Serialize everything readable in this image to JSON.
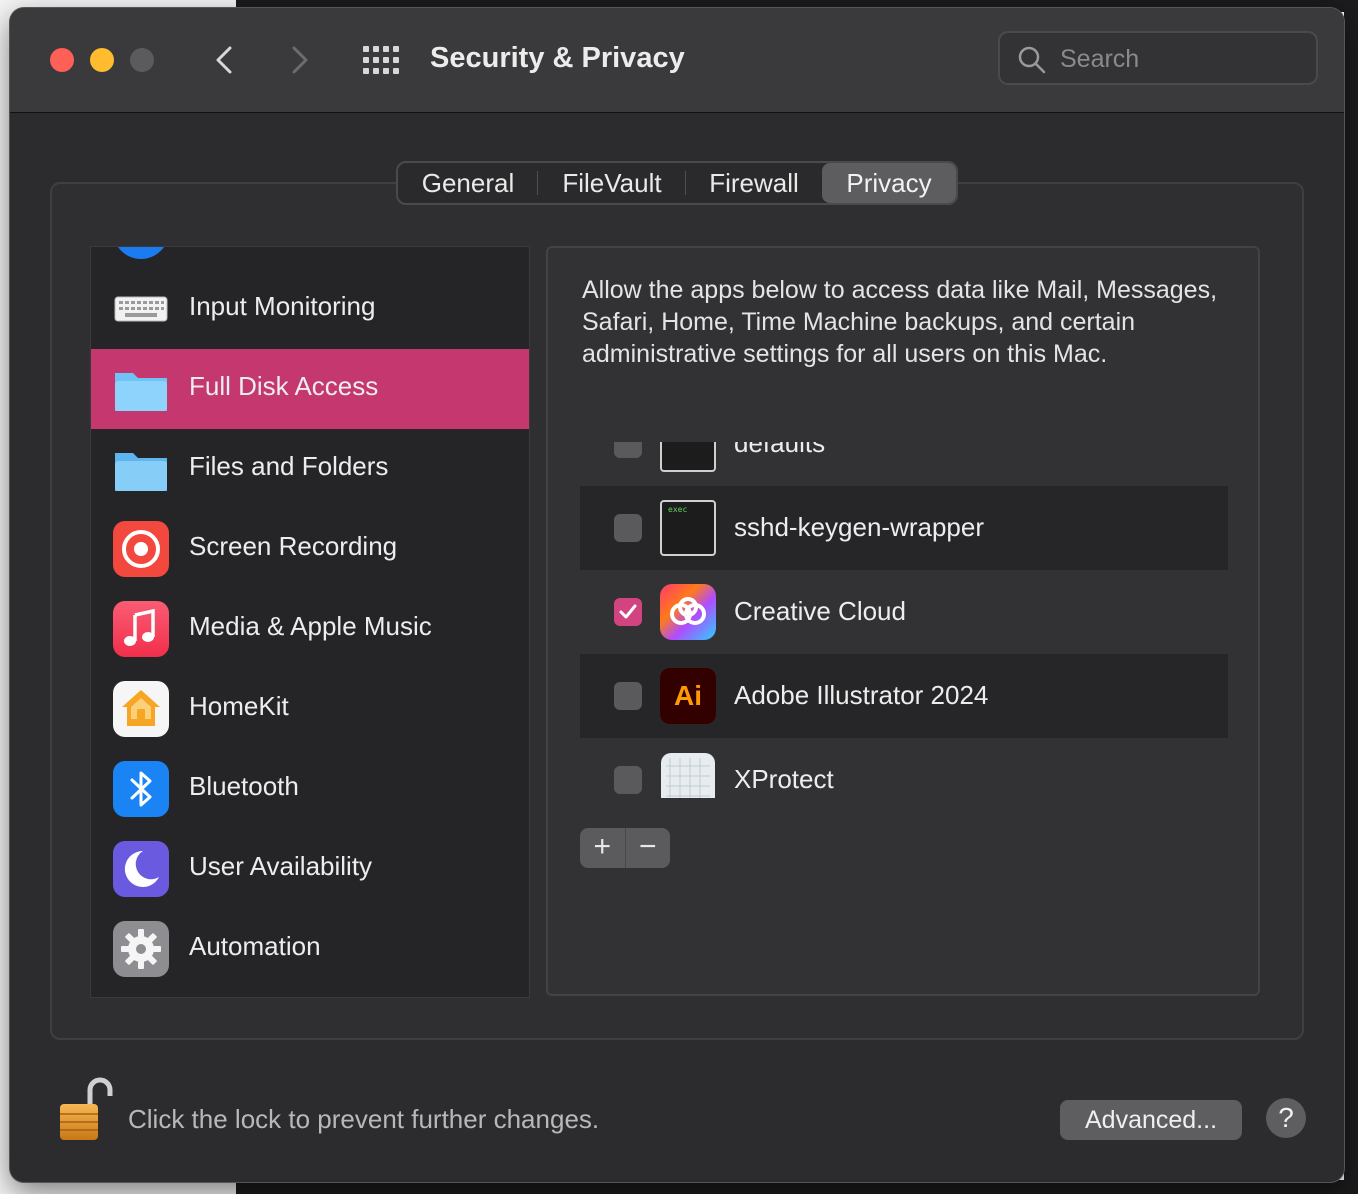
{
  "window": {
    "title": "Security & Privacy"
  },
  "search": {
    "placeholder": "Search"
  },
  "tabs": [
    {
      "label": "General"
    },
    {
      "label": "FileVault"
    },
    {
      "label": "Firewall"
    },
    {
      "label": "Privacy",
      "active": true
    }
  ],
  "sidebar": {
    "items": [
      {
        "label": "Input Monitoring",
        "icon": "keyboard-icon"
      },
      {
        "label": "Full Disk Access",
        "icon": "folder-icon",
        "selected": true
      },
      {
        "label": "Files and Folders",
        "icon": "folder-icon"
      },
      {
        "label": "Screen Recording",
        "icon": "screen-recording-icon"
      },
      {
        "label": "Media & Apple Music",
        "icon": "music-note-icon"
      },
      {
        "label": "HomeKit",
        "icon": "home-icon"
      },
      {
        "label": "Bluetooth",
        "icon": "bluetooth-icon"
      },
      {
        "label": "User Availability",
        "icon": "moon-icon"
      },
      {
        "label": "Automation",
        "icon": "gear-icon"
      }
    ]
  },
  "content": {
    "description": "Allow the apps below to access data like Mail, Messages, Safari, Home, Time Machine backups, and certain administrative settings for all users on this Mac.",
    "apps": [
      {
        "name": "defaults",
        "checked": false,
        "icon": "terminal-exec-icon"
      },
      {
        "name": "sshd-keygen-wrapper",
        "checked": false,
        "icon": "terminal-exec-icon",
        "icon_text": "exec"
      },
      {
        "name": "Creative Cloud",
        "checked": true,
        "icon": "creative-cloud-icon"
      },
      {
        "name": "Adobe Illustrator 2024",
        "checked": false,
        "icon": "illustrator-icon",
        "icon_text": "Ai"
      },
      {
        "name": "XProtect",
        "checked": false,
        "icon": "xprotect-icon"
      }
    ],
    "add_label": "+",
    "remove_label": "−"
  },
  "footer": {
    "lock_text": "Click the lock to prevent further changes.",
    "advanced_label": "Advanced...",
    "help_label": "?"
  },
  "colors": {
    "selection": "#c4376f",
    "checkbox_on": "#d2447f",
    "window_bg": "#2c2c2e"
  }
}
